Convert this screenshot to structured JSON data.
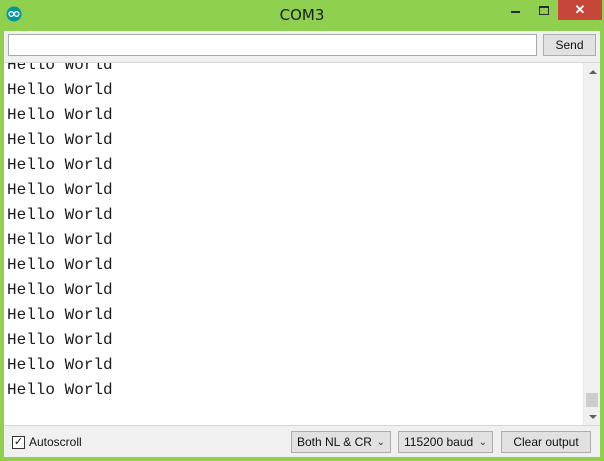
{
  "window": {
    "title": "COM3",
    "app_icon": "arduino-infinity-icon",
    "accent_color": "#8fd14f",
    "close_symbol": "✕"
  },
  "send_bar": {
    "input_value": "",
    "input_placeholder": "",
    "send_label": "Send"
  },
  "output": {
    "lines": [
      "Hello World",
      "Hello World",
      "Hello World",
      "Hello World",
      "Hello World",
      "Hello World",
      "Hello World",
      "Hello World",
      "Hello World",
      "Hello World",
      "Hello World",
      "Hello World",
      "Hello World",
      "Hello World"
    ],
    "scroll_position": "bottom"
  },
  "bottom_bar": {
    "autoscroll_label": "Autoscroll",
    "autoscroll_checked": true,
    "line_ending_selected": "Both NL & CR",
    "baud_selected": "115200 baud",
    "clear_label": "Clear output"
  }
}
